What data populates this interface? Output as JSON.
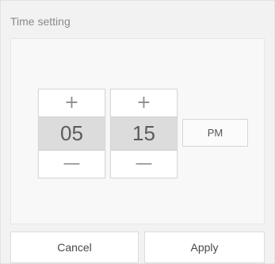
{
  "dialog": {
    "title": "Time setting"
  },
  "time_picker": {
    "hour": {
      "increment_symbol": "+",
      "value": "05",
      "decrement_symbol": "—"
    },
    "minute": {
      "increment_symbol": "+",
      "value": "15",
      "decrement_symbol": "—"
    },
    "period": "PM"
  },
  "actions": {
    "cancel_label": "Cancel",
    "apply_label": "Apply"
  },
  "icons": {
    "increment": "plus-icon",
    "decrement": "minus-icon"
  },
  "colors": {
    "selected_value_bg": "#dcdcdc",
    "dialog_bg": "#f2f2f2"
  }
}
